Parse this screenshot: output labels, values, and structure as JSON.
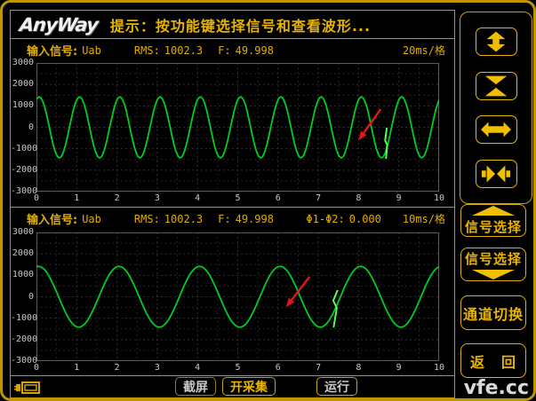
{
  "window": {
    "logo": "AnyWay",
    "title": "提示：按功能键选择信号和查看波形..."
  },
  "panels": [
    {
      "signal_label": "输入信号:",
      "signal_value": "Uab",
      "rms_label": "RMS:",
      "rms_value": "1002.3",
      "freq_label": "F:",
      "freq_value": "49.998",
      "timebase": "20ms/格"
    },
    {
      "signal_label": "输入信号:",
      "signal_value": "Uab",
      "rms_label": "RMS:",
      "rms_value": "1002.3",
      "freq_label": "F:",
      "freq_value": "49.998",
      "phase_label": "Φ1-Φ2:",
      "phase_value": "0.000",
      "timebase": "10ms/格"
    }
  ],
  "chart_data": [
    {
      "type": "line",
      "title": "输入信号 Uab 波形 (上)",
      "timebase_per_division": "20ms",
      "x_divisions": 10,
      "x_ticks": [
        0,
        1,
        2,
        3,
        4,
        5,
        6,
        7,
        8,
        9,
        10
      ],
      "y_ticks": [
        3000,
        2000,
        1000,
        0,
        -1000,
        -2000,
        -3000
      ],
      "ylim": [
        -3000,
        3000
      ],
      "grid": true,
      "series": [
        {
          "name": "Uab",
          "waveform": "sine",
          "rms": 1002.3,
          "frequency_hz": 49.998,
          "amplitude": 1417,
          "period_divisions": 1,
          "peak_at_division": 0.07,
          "color": "#00cc22"
        }
      ],
      "annotations": {
        "spike": {
          "color": "#55ff55",
          "points": [
            [
              8.7,
              -20
            ],
            [
              8.66,
              -620
            ],
            [
              8.71,
              -820
            ],
            [
              8.68,
              -1470
            ]
          ]
        },
        "arrow": {
          "color": "#e01818",
          "from": [
            8.55,
            850
          ],
          "to": [
            8.0,
            -600
          ]
        }
      }
    },
    {
      "type": "line",
      "title": "输入信号 Uab 波形 (下)",
      "timebase_per_division": "10ms",
      "x_divisions": 10,
      "x_ticks": [
        0,
        1,
        2,
        3,
        4,
        5,
        6,
        7,
        8,
        9,
        10
      ],
      "y_ticks": [
        3000,
        2000,
        1000,
        0,
        -1000,
        -2000,
        -3000
      ],
      "ylim": [
        -3000,
        3000
      ],
      "grid": true,
      "series": [
        {
          "name": "Uab",
          "waveform": "sine",
          "rms": 1002.3,
          "frequency_hz": 49.998,
          "amplitude": 1417,
          "period_divisions": 2,
          "peak_at_division": 0.05,
          "color": "#00cc22"
        }
      ],
      "annotations": {
        "spike": {
          "color": "#55ff55",
          "points": [
            [
              7.48,
              310
            ],
            [
              7.37,
              -180
            ],
            [
              7.46,
              -520
            ],
            [
              7.38,
              -1430
            ]
          ]
        },
        "arrow": {
          "color": "#e01818",
          "from": [
            6.78,
            930
          ],
          "to": [
            6.2,
            -480
          ]
        }
      }
    }
  ],
  "sidebar": {
    "zoom_buttons": [
      {
        "icon": "expand-vertical-icon"
      },
      {
        "icon": "compress-vertical-icon"
      },
      {
        "icon": "expand-horizontal-icon"
      },
      {
        "icon": "compress-horizontal-icon"
      }
    ],
    "signal_select_up": "信号选择",
    "signal_select_down": "信号选择",
    "channel_switch": "通道切换",
    "return_left": "返",
    "return_right": "回"
  },
  "bottom_bar": {
    "screenshot": "截屏",
    "start_capture": "开采集",
    "run": "运行"
  },
  "watermark": "vfe.cc",
  "colors": {
    "accent": "#c8a000",
    "text_yellow": "#e8b400",
    "wave_green": "#00cc22",
    "spike_green": "#55ff55",
    "arrow_red": "#e01818"
  }
}
